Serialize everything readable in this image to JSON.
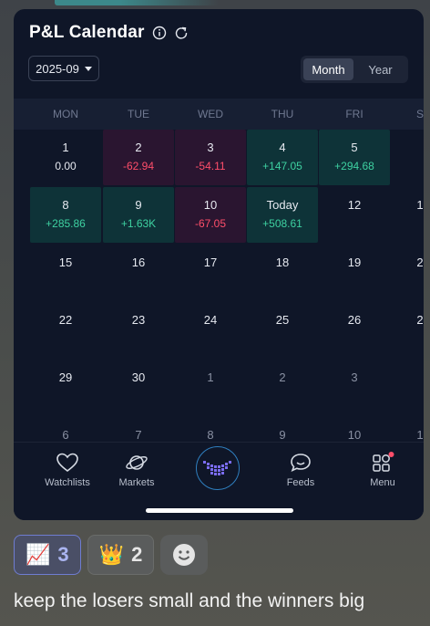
{
  "pnl": {
    "title": "P&L Calendar",
    "month": "2025-09",
    "view_toggle": {
      "month": "Month",
      "year": "Year",
      "selected": "Month"
    },
    "weekdays": [
      "MON",
      "TUE",
      "WED",
      "THU",
      "FRI",
      "S"
    ],
    "rows": [
      [
        {
          "day": "1",
          "value": "0.00",
          "status": "neutral"
        },
        {
          "day": "2",
          "value": "-62.94",
          "status": "loss"
        },
        {
          "day": "3",
          "value": "-54.11",
          "status": "loss"
        },
        {
          "day": "4",
          "value": "+147.05",
          "status": "gain"
        },
        {
          "day": "5",
          "value": "+294.68",
          "status": "gain"
        },
        {
          "day": "",
          "value": "",
          "status": "none"
        }
      ],
      [
        {
          "day": "8",
          "value": "+285.86",
          "status": "gain"
        },
        {
          "day": "9",
          "value": "+1.63K",
          "status": "gain"
        },
        {
          "day": "10",
          "value": "-67.05",
          "status": "loss"
        },
        {
          "day": "Today",
          "value": "+508.61",
          "status": "gain"
        },
        {
          "day": "12",
          "value": "",
          "status": "none"
        },
        {
          "day": "1",
          "value": "",
          "status": "none"
        }
      ],
      [
        {
          "day": "15",
          "value": "",
          "status": "none"
        },
        {
          "day": "16",
          "value": "",
          "status": "none"
        },
        {
          "day": "17",
          "value": "",
          "status": "none"
        },
        {
          "day": "18",
          "value": "",
          "status": "none"
        },
        {
          "day": "19",
          "value": "",
          "status": "none"
        },
        {
          "day": "2",
          "value": "",
          "status": "none"
        }
      ],
      [
        {
          "day": "22",
          "value": "",
          "status": "none"
        },
        {
          "day": "23",
          "value": "",
          "status": "none"
        },
        {
          "day": "24",
          "value": "",
          "status": "none"
        },
        {
          "day": "25",
          "value": "",
          "status": "none"
        },
        {
          "day": "26",
          "value": "",
          "status": "none"
        },
        {
          "day": "2",
          "value": "",
          "status": "none"
        }
      ],
      [
        {
          "day": "29",
          "value": "",
          "status": "none"
        },
        {
          "day": "30",
          "value": "",
          "status": "none"
        },
        {
          "day": "1",
          "value": "",
          "status": "muted"
        },
        {
          "day": "2",
          "value": "",
          "status": "muted"
        },
        {
          "day": "3",
          "value": "",
          "status": "muted"
        },
        {
          "day": "",
          "value": "",
          "status": "none"
        }
      ],
      [
        {
          "day": "6",
          "value": "",
          "status": "muted"
        },
        {
          "day": "7",
          "value": "",
          "status": "muted"
        },
        {
          "day": "8",
          "value": "",
          "status": "muted"
        },
        {
          "day": "9",
          "value": "",
          "status": "muted"
        },
        {
          "day": "10",
          "value": "",
          "status": "muted"
        },
        {
          "day": "1",
          "value": "",
          "status": "muted"
        }
      ]
    ]
  },
  "nav": {
    "items": [
      {
        "label": "Watchlists",
        "icon": "heart-icon"
      },
      {
        "label": "Markets",
        "icon": "planet-icon"
      },
      {
        "label": "",
        "icon": "center-logo-icon"
      },
      {
        "label": "Feeds",
        "icon": "chat-smile-icon"
      },
      {
        "label": "Menu",
        "icon": "grid-menu-icon",
        "badge": true
      }
    ]
  },
  "reactions": [
    {
      "emoji": "📈",
      "count": "3",
      "selected": true,
      "icon": "chart-up-icon"
    },
    {
      "emoji": "👑",
      "count": "2",
      "selected": false,
      "icon": "crown-icon"
    }
  ],
  "add_reaction_icon": "smiley-add-icon",
  "message": "keep the losers small and the winners big",
  "colors": {
    "gain": "#3ed1a1",
    "loss": "#ff4e6a",
    "accent": "#2f7fbf",
    "panel": "#0f1628"
  }
}
